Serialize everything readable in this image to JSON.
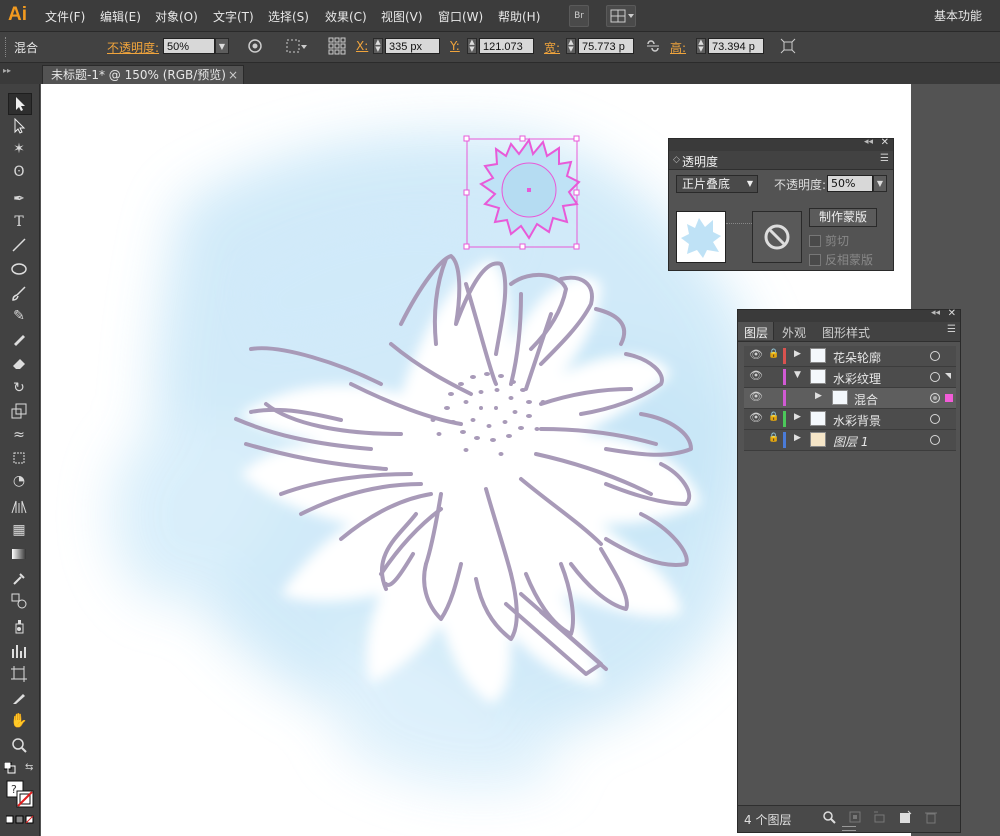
{
  "app": {
    "logo": "Ai"
  },
  "menubar": {
    "items": [
      "文件(F)",
      "编辑(E)",
      "对象(O)",
      "文字(T)",
      "选择(S)",
      "效果(C)",
      "视图(V)",
      "窗口(W)",
      "帮助(H)"
    ],
    "bridge_button": "Br",
    "workspace": "基本功能"
  },
  "control_bar": {
    "mode_label": "混合",
    "opacity_label": "不透明度:",
    "opacity_value": "50%",
    "x_label": "X:",
    "x_value": "335 px",
    "y_label": "Y:",
    "y_value": "121.073",
    "w_label": "宽:",
    "w_value": "75.773 p",
    "h_label": "高:",
    "h_value": "73.394 p"
  },
  "document_tab": {
    "title": "未标题-1* @ 150% (RGB/预览)",
    "close": "×"
  },
  "transparency_panel": {
    "title": "透明度",
    "blend_mode": "正片叠底",
    "opacity_label": "不透明度:",
    "opacity_value": "50%",
    "make_mask_button": "制作蒙版",
    "clip_label": "剪切",
    "invert_mask_label": "反相蒙版"
  },
  "layers_panel": {
    "tabs": [
      "图层",
      "外观",
      "图形样式"
    ],
    "layers": [
      {
        "name": "花朵轮廓",
        "color": "#d9534f"
      },
      {
        "name": "水彩纹理",
        "color": "#d15ad4"
      },
      {
        "name": "混合",
        "color": "#d15ad4"
      },
      {
        "name": "水彩背景",
        "color": "#4cc85a"
      },
      {
        "name": "图层 1",
        "color": "#4a7bd8"
      }
    ],
    "footer_count": "4 个图层"
  },
  "colors": {
    "accent_orange": "#f0a43c",
    "selection_magenta": "#f25cd8",
    "watercolor_blue": "#bfe3f7",
    "flower_outline": "#a89ab8"
  }
}
